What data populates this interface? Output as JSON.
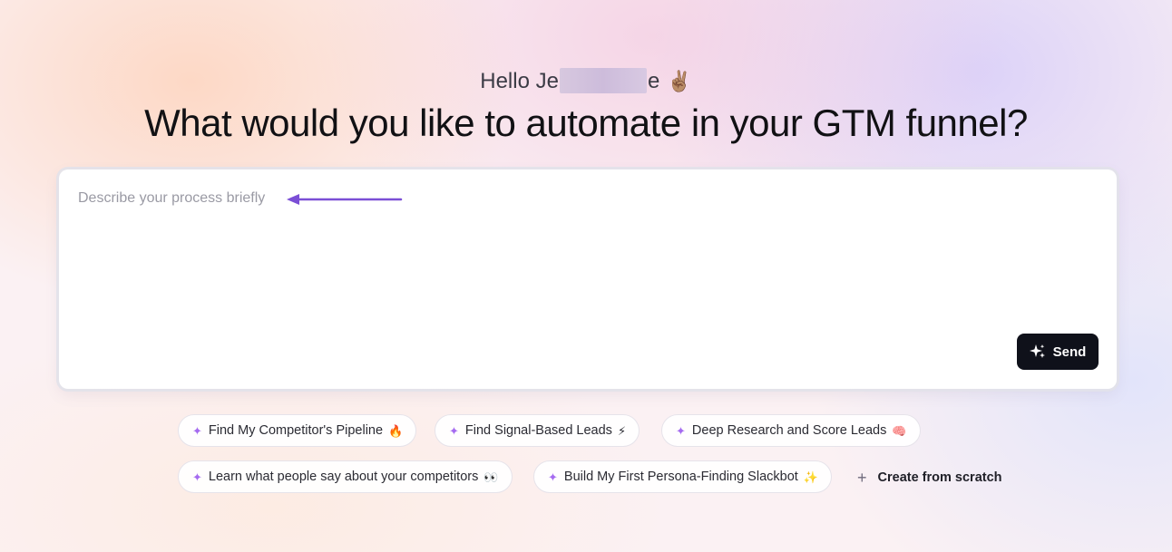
{
  "greeting": {
    "prefix": "Hello Je",
    "suffix": "e",
    "emoji": "✌🏽"
  },
  "headline": "What would you like to automate in your GTM funnel?",
  "composer": {
    "placeholder": "Describe your process briefly",
    "arrow_color": "#7b4fd6",
    "send_label": "Send",
    "send_icon": "sparkle-stars-icon"
  },
  "suggestions": [
    {
      "label": "Find My Competitor's Pipeline",
      "emoji": "🔥"
    },
    {
      "label": "Find Signal-Based Leads",
      "emoji": "⚡"
    },
    {
      "label": "Deep Research and Score Leads",
      "emoji": "🧠"
    },
    {
      "label": "Learn what people say about your competitors",
      "emoji": "👀"
    },
    {
      "label": "Build My First Persona-Finding Slackbot",
      "emoji": "✨"
    }
  ],
  "create_from_scratch": {
    "icon": "plus-icon",
    "label": "Create from scratch"
  },
  "colors": {
    "accent_purple": "#a56bf0",
    "button_dark": "#0f111a"
  }
}
